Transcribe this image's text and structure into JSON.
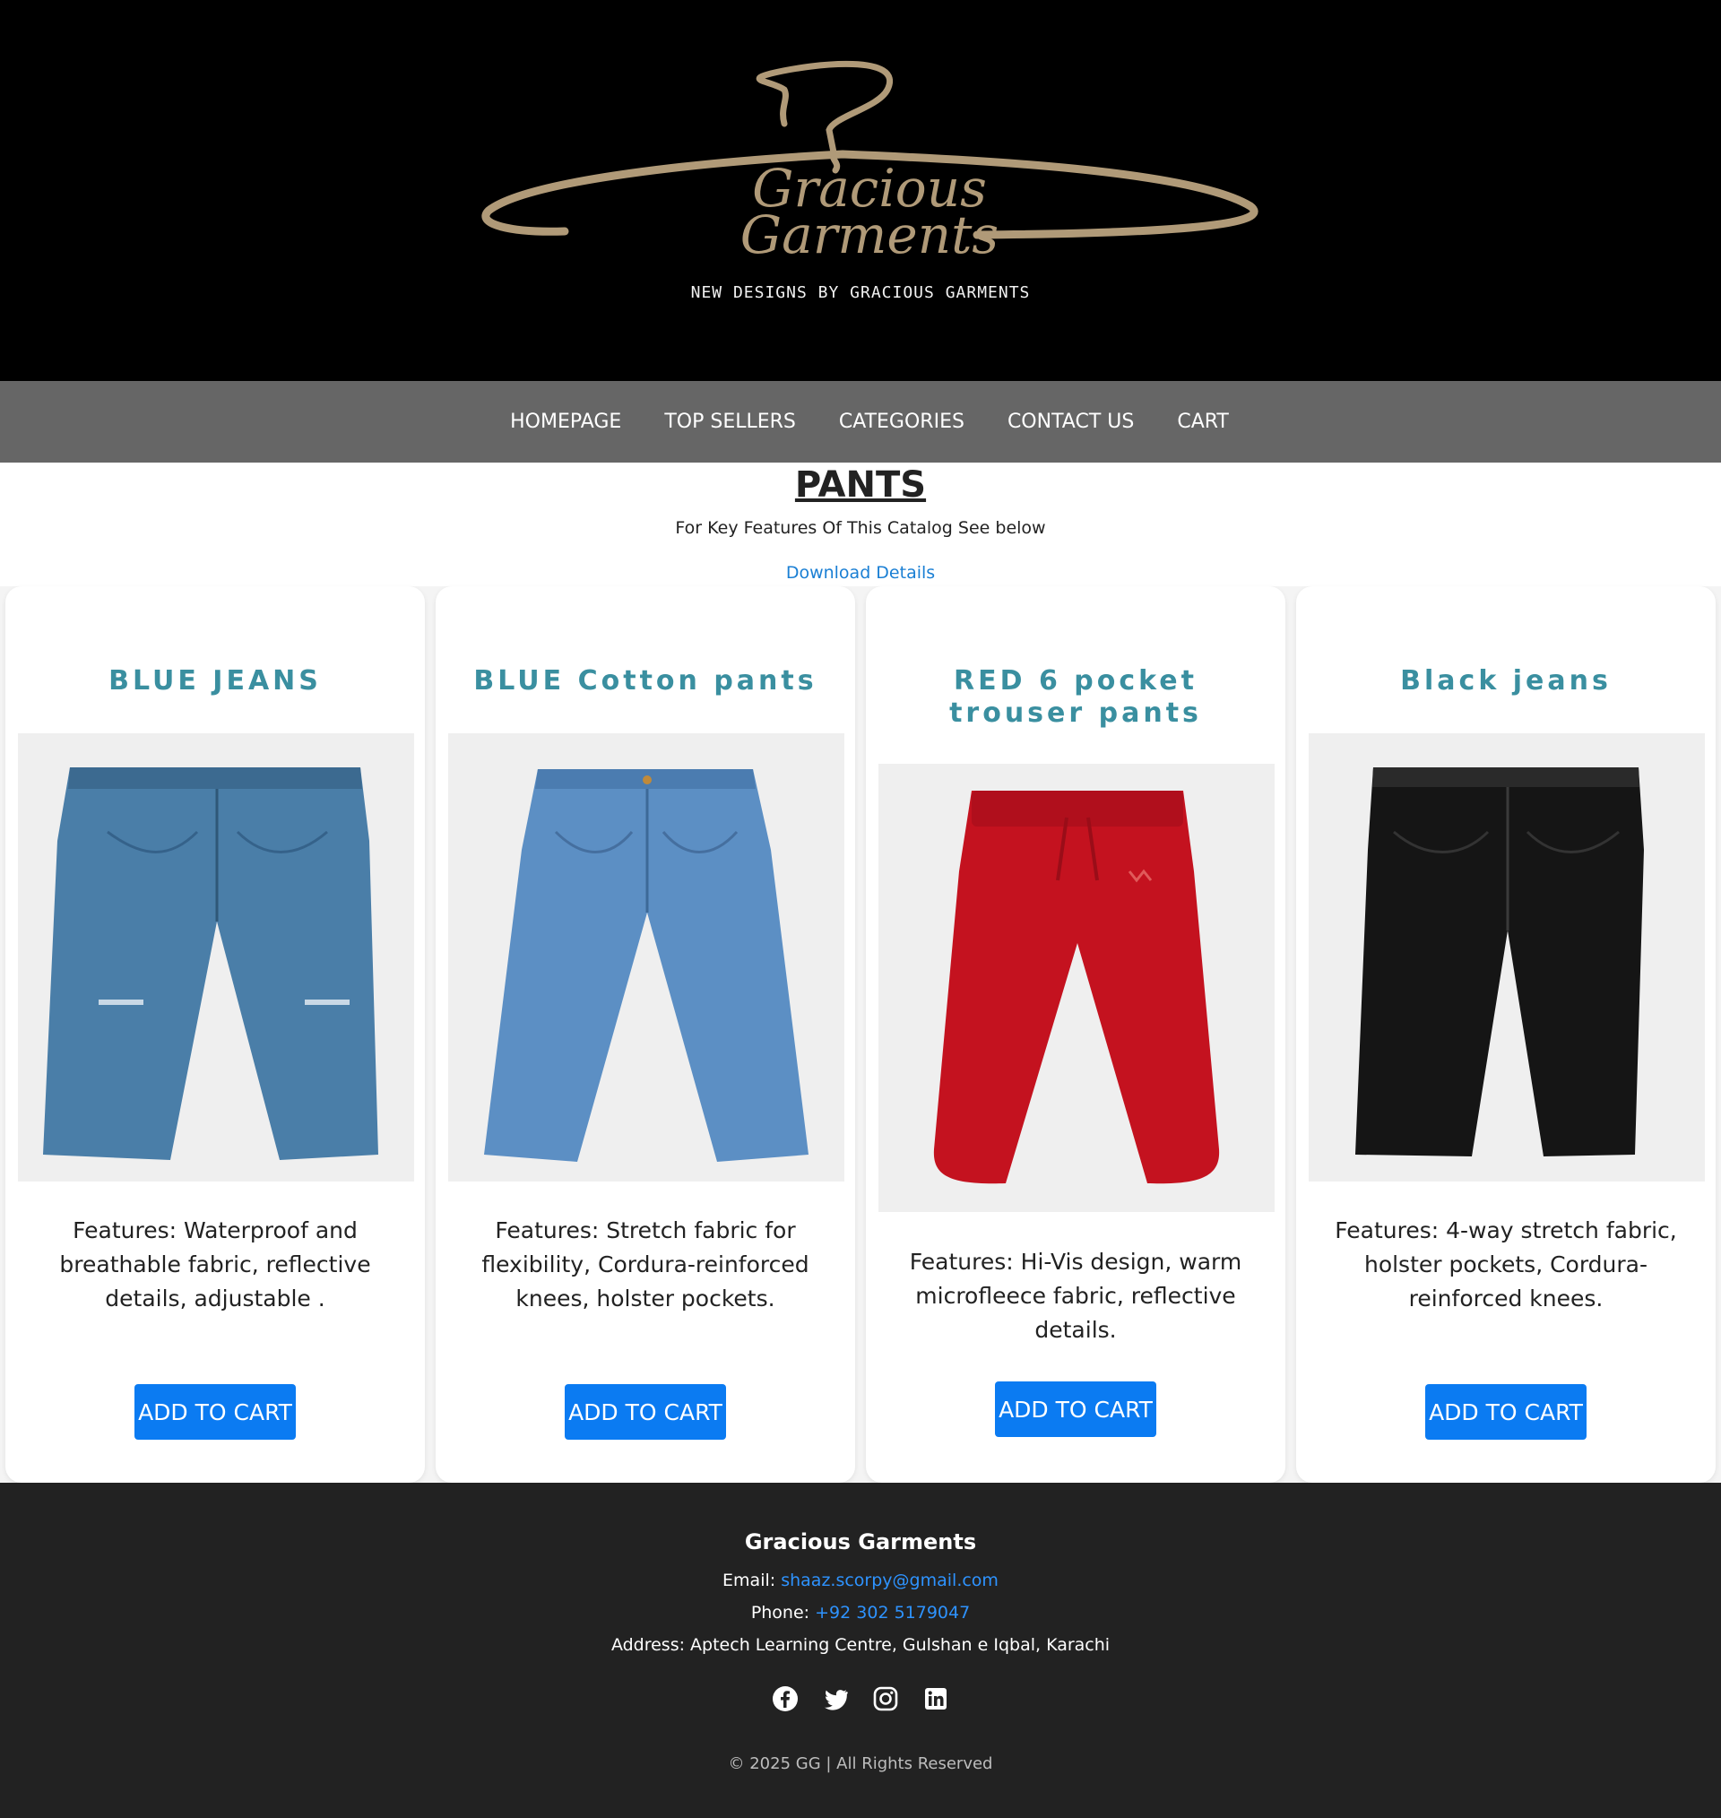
{
  "header": {
    "logo_text_top": "Gracious",
    "logo_text_bottom": "Garments",
    "tagline": "NEW DESIGNS BY GRACIOUS GARMENTS"
  },
  "nav": {
    "items": [
      "HOMEPAGE",
      "TOP SELLERS",
      "CATEGORIES",
      "CONTACT US",
      "CART"
    ]
  },
  "main": {
    "title": "PANTS",
    "subtitle": "For Key Features Of This Catalog See below",
    "download_label": "Download Details"
  },
  "products": [
    {
      "title": "BLUE JEANS",
      "description": "Features: Waterproof and breathable fabric, reflective details, adjustable .",
      "button": "ADD TO CART",
      "color": "#4a7ea8"
    },
    {
      "title": "BLUE Cotton pants",
      "description": "Features: Stretch fabric for flexibility, Cordura-reinforced knees, holster pockets.",
      "button": "ADD TO CART",
      "color": "#5c8fc4"
    },
    {
      "title": "RED 6 pocket trouser pants",
      "description": "Features: Hi-Vis design, warm microfleece fabric, reflective details.",
      "button": "ADD TO CART",
      "color": "#c4121f"
    },
    {
      "title": "Black jeans",
      "description": "Features: 4-way stretch fabric, holster pockets, Cordura-reinforced knees.",
      "button": "ADD TO CART",
      "color": "#151515"
    }
  ],
  "footer": {
    "brand": "Gracious Garments",
    "email_label": "Email:",
    "email": "shaaz.scorpy@gmail.com",
    "phone_label": "Phone:",
    "phone": "+92 302 5179047",
    "address": "Address: Aptech Learning Centre, Gulshan e Iqbal, Karachi",
    "social": [
      "facebook-icon",
      "twitter-icon",
      "instagram-icon",
      "linkedin-icon"
    ],
    "copyright": "© 2025 GG | All Rights Reserved"
  },
  "colors": {
    "accent_title": "#3a8fa0",
    "button": "#0b7bf2",
    "nav_bg": "#666666",
    "footer_bg": "#222222",
    "link": "#2e93ff"
  }
}
